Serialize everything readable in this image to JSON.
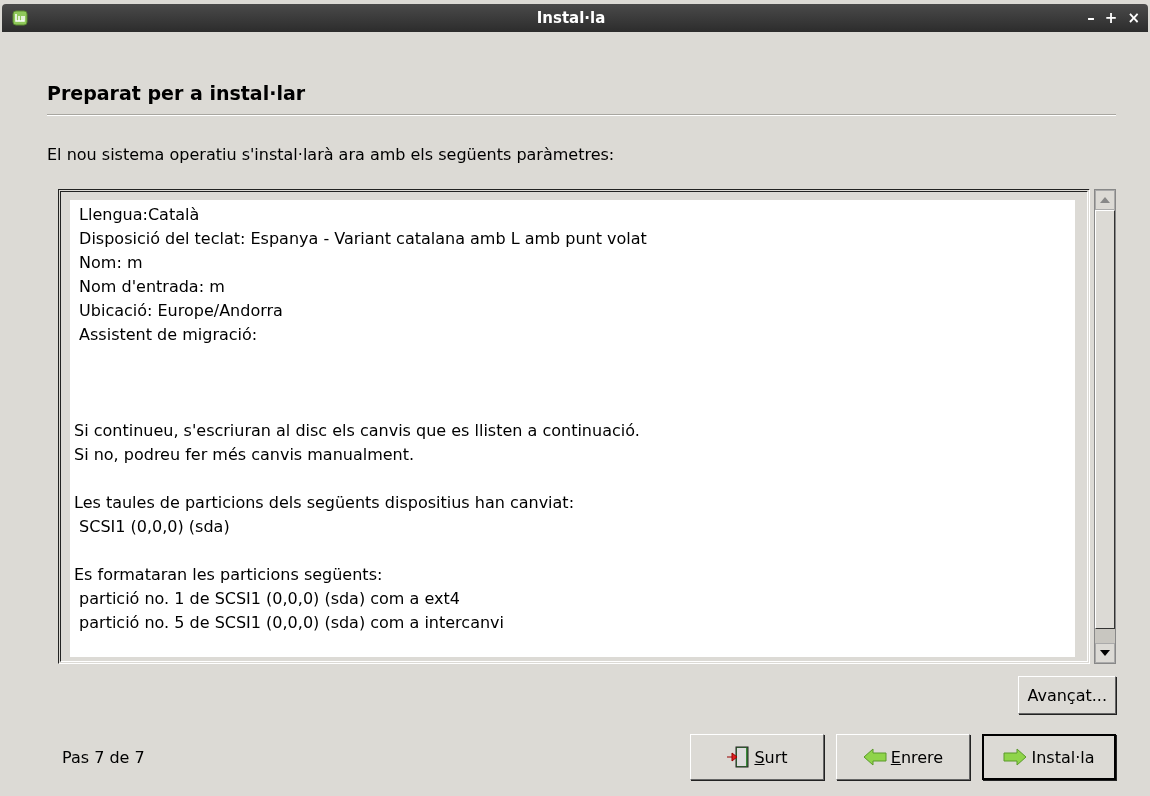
{
  "window": {
    "title": "Instal·la",
    "controls": [
      "–",
      "+",
      "×"
    ]
  },
  "heading": "Preparat per a instal·lar",
  "intro": "El nou sistema operatiu s'instal·larà ara amb els següents paràmetres:",
  "summary": [
    {
      "lines": [
        " Llengua:Català",
        " Disposició del teclat: Espanya - Variant catalana amb L amb punt volat",
        " Nom: m",
        " Nom d'entrada: m",
        " Ubicació: Europe/Andorra",
        " Assistent de migració:"
      ]
    },
    {
      "lines": [
        "Si continueu, s'escriuran al disc els canvis que es llisten a continuació.",
        "Si no, podreu fer més canvis manualment."
      ]
    },
    {
      "lines": [
        "Les taules de particions dels següents dispositius han canviat:",
        " SCSI1 (0,0,0) (sda)"
      ]
    },
    {
      "lines": [
        "Es formataran les particions següents:",
        " partició no. 1 de SCSI1 (0,0,0) (sda) com a ext4",
        " partició no. 5 de SCSI1 (0,0,0) (sda) com a intercanvi"
      ]
    }
  ],
  "advanced_button": "Avançat...",
  "step": "Pas 7 de 7",
  "buttons": [
    {
      "label": "Surt",
      "kind": "quit",
      "underline_first": true,
      "default": false
    },
    {
      "label": "Enrere",
      "kind": "back",
      "underline_first": true,
      "default": false
    },
    {
      "label": "Instal·la",
      "kind": "forward",
      "underline_first": false,
      "default": true
    }
  ]
}
